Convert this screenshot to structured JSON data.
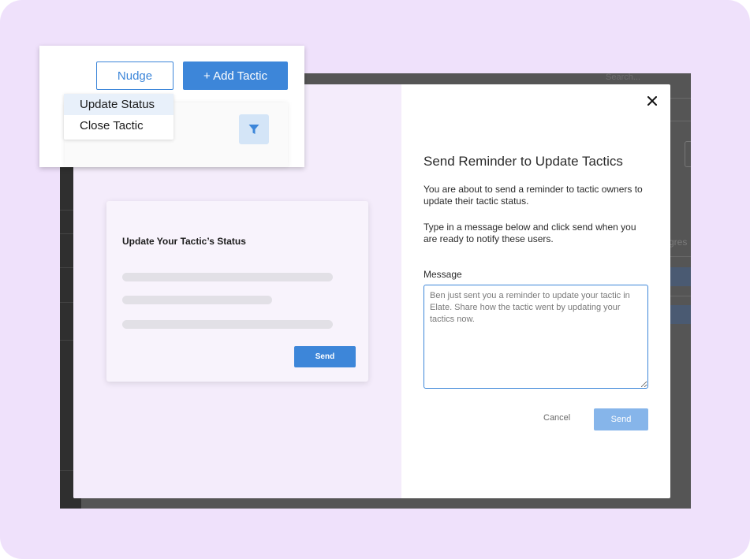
{
  "background_app": {
    "search_placeholder": "Search...",
    "partial_column_header": "gres"
  },
  "callout": {
    "nudge_label": "Nudge",
    "add_tactic_label": "+ Add Tactic",
    "dropdown_items": [
      "Update Status",
      "Close Tactic"
    ],
    "filter_icon": "filter-icon"
  },
  "preview_card": {
    "title": "Update Your Tactic’s Status",
    "send_label": "Send"
  },
  "modal": {
    "close_icon": "close-icon",
    "title": "Send Reminder to Update Tactics",
    "paragraph1": "You are about to send a reminder to tactic owners to update their tactic status.",
    "paragraph2": "Type in a message below and click send when you are ready to notify these users.",
    "message_label": "Message",
    "message_value": "Ben just sent you a reminder to update your tactic in Elate. Share how the tactic went by updating your tactics now.",
    "cancel_label": "Cancel",
    "send_label": "Send"
  },
  "colors": {
    "canvas_bg": "#efe1fb",
    "primary": "#3d86d9",
    "primary_disabled": "#86b5ea",
    "backdrop": "#555555"
  }
}
